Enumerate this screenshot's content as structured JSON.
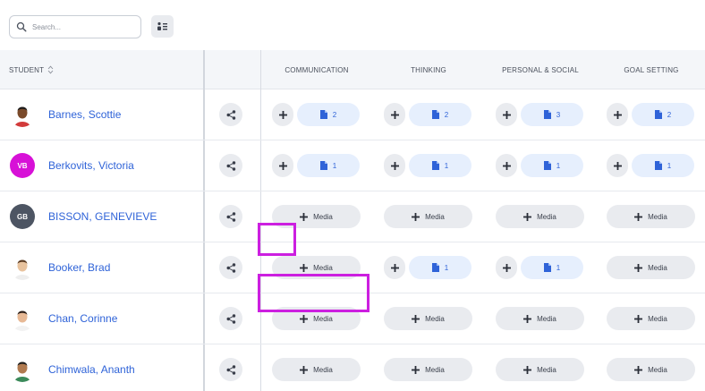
{
  "search": {
    "placeholder": "Search..."
  },
  "header": {
    "student": "STUDENT",
    "columns": [
      "COMMUNICATION",
      "THINKING",
      "PERSONAL & SOCIAL",
      "GOAL SETTING"
    ]
  },
  "media_label": "Media",
  "colors": {
    "accent": "#2f63d8",
    "highlight": "#cc1fe0",
    "pill": "#e9ebef",
    "count_pill": "#e6effd"
  },
  "students": [
    {
      "name": "Barnes, Scottie",
      "avatar_initials": "",
      "avatar_kind": "photo-1",
      "cells": [
        {
          "type": "count",
          "value": "2"
        },
        {
          "type": "count",
          "value": "2"
        },
        {
          "type": "count",
          "value": "3"
        },
        {
          "type": "count",
          "value": "2"
        }
      ]
    },
    {
      "name": "Berkovits, Victoria",
      "avatar_initials": "VB",
      "avatar_kind": "initials-magenta",
      "cells": [
        {
          "type": "count",
          "value": "1"
        },
        {
          "type": "count",
          "value": "1"
        },
        {
          "type": "count",
          "value": "1"
        },
        {
          "type": "count",
          "value": "1"
        }
      ]
    },
    {
      "name": "BISSON, GENEVIEVE",
      "avatar_initials": "GB",
      "avatar_kind": "initials-gray",
      "cells": [
        {
          "type": "media"
        },
        {
          "type": "media"
        },
        {
          "type": "media"
        },
        {
          "type": "media"
        }
      ]
    },
    {
      "name": "Booker, Brad",
      "avatar_initials": "",
      "avatar_kind": "photo-2",
      "cells": [
        {
          "type": "media"
        },
        {
          "type": "count",
          "value": "1"
        },
        {
          "type": "count",
          "value": "1"
        },
        {
          "type": "media"
        }
      ]
    },
    {
      "name": "Chan, Corinne",
      "avatar_initials": "",
      "avatar_kind": "photo-3",
      "cells": [
        {
          "type": "media"
        },
        {
          "type": "media"
        },
        {
          "type": "media"
        },
        {
          "type": "media"
        }
      ]
    },
    {
      "name": "Chimwala, Ananth",
      "avatar_initials": "",
      "avatar_kind": "photo-4",
      "cells": [
        {
          "type": "media"
        },
        {
          "type": "media"
        },
        {
          "type": "media"
        },
        {
          "type": "media"
        }
      ]
    }
  ]
}
